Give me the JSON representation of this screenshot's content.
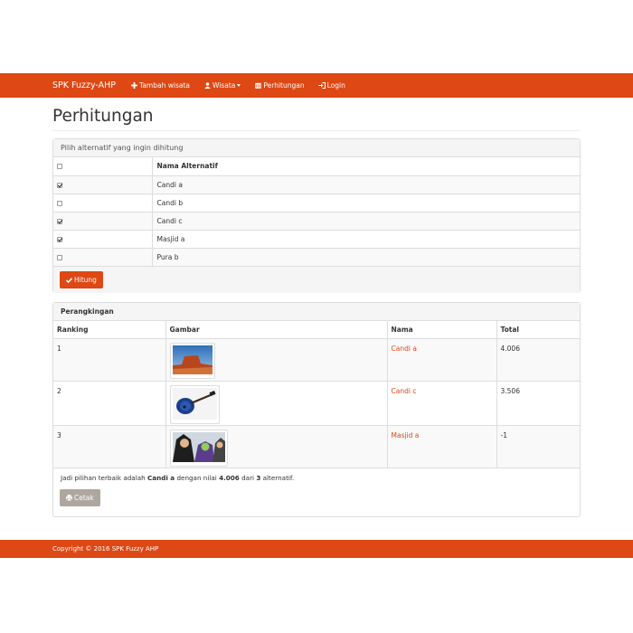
{
  "navbar": {
    "brand": "SPK Fuzzy-AHP",
    "items": [
      {
        "label": "Tambah wisata",
        "icon": "plus-icon"
      },
      {
        "label": "Wisata",
        "icon": "user-icon",
        "dropdown": true
      },
      {
        "label": "Perhitungan",
        "icon": "calendar-icon"
      },
      {
        "label": "Login",
        "icon": "login-icon"
      }
    ]
  },
  "page": {
    "title": "Perhitungan"
  },
  "pilih": {
    "heading": "Pilih alternatif yang ingin dihitung",
    "column_header": "Nama Alternatif",
    "header_checked": false,
    "rows": [
      {
        "name": "Candi a",
        "checked": true
      },
      {
        "name": "Candi b",
        "checked": false
      },
      {
        "name": "Candi c",
        "checked": true
      },
      {
        "name": "Masjid a",
        "checked": true
      },
      {
        "name": "Pura b",
        "checked": false
      }
    ],
    "button_label": "Hitung"
  },
  "ranking": {
    "heading": "Perangkingan",
    "headers": [
      "Ranking",
      "Gambar",
      "Nama",
      "Total"
    ],
    "rows": [
      {
        "rank": "1",
        "image": "desert-mesa-photo",
        "name": "Candi a",
        "total": "4.006"
      },
      {
        "rank": "2",
        "image": "blue-guitar-photo",
        "name": "Candi c",
        "total": "3.506"
      },
      {
        "rank": "3",
        "image": "anime-characters-photo",
        "name": "Masjid a",
        "total": "-1"
      }
    ],
    "summary": {
      "prefix": "Jadi pilihan terbaik adalah",
      "best": "Candi a",
      "mid": "dengan nilai",
      "value": "4.006",
      "from": "dari",
      "count": "3",
      "suffix": "alternatif."
    },
    "print_label": "Cetak"
  },
  "footer": {
    "text": "Copyright © 2016 SPK Fuzzy AHP"
  },
  "colors": {
    "primary": "#dd4814",
    "secondary": "#aea79f"
  }
}
